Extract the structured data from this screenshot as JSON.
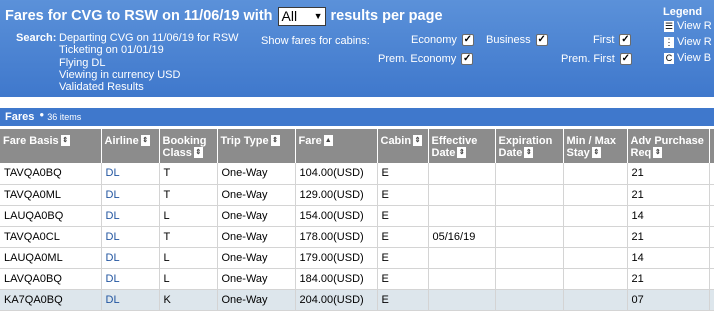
{
  "header": {
    "title_prefix": "Fares for CVG to RSW on 11/06/19 with",
    "per_page_value": "All",
    "title_suffix": "results per page",
    "search_label": "Search:",
    "search_lines": [
      "Departing CVG on 11/06/19 for RSW",
      "Ticketing on 01/01/19",
      "Flying DL",
      "Viewing in currency USD",
      "Validated Results"
    ],
    "cabins_label": "Show fares for cabins:",
    "cabins": [
      {
        "label": "Economy",
        "checked": true
      },
      {
        "label": "Business",
        "checked": true
      },
      {
        "label": "First",
        "checked": true
      },
      {
        "label": "Prem. Economy",
        "checked": true
      },
      {
        "label": "Prem. First",
        "checked": true
      }
    ],
    "legend": {
      "title": "Legend",
      "items": [
        {
          "icon": "view-rules-icon",
          "label": "View R"
        },
        {
          "icon": "view-routing-icon",
          "label": "View R"
        },
        {
          "icon": "view-b-icon",
          "label": "View B"
        }
      ]
    }
  },
  "fares": {
    "label": "Fares",
    "count": "36 items"
  },
  "table": {
    "headers": [
      {
        "line1": "Fare Basis",
        "line2": "",
        "sort": "sort-icon"
      },
      {
        "line1": "Airline",
        "line2": "",
        "sort": "sort-icon"
      },
      {
        "line1": "Booking",
        "line2": "Class",
        "sort": "sort-icon"
      },
      {
        "line1": "Trip Type",
        "line2": "",
        "sort": "sort-icon"
      },
      {
        "line1": "Fare",
        "line2": "",
        "sort": "sort-ascending-icon"
      },
      {
        "line1": "Cabin",
        "line2": "",
        "sort": "sort-icon"
      },
      {
        "line1": "Effective",
        "line2": "Date",
        "sort": "sort-icon"
      },
      {
        "line1": "Expiration",
        "line2": "Date",
        "sort": "sort-icon"
      },
      {
        "line1": "Min / Max",
        "line2": "Stay",
        "sort": "sort-icon"
      },
      {
        "line1": "Adv Purchase",
        "line2": "Req",
        "sort": "sort-icon"
      },
      {
        "line1": "",
        "line2": "",
        "sort": ""
      }
    ],
    "rows": [
      [
        "TAVQA0BQ",
        "DL",
        "T",
        "One-Way",
        "104.00(USD)",
        "E",
        "",
        "",
        "",
        "21",
        ""
      ],
      [
        "TAVQA0ML",
        "DL",
        "T",
        "One-Way",
        "129.00(USD)",
        "E",
        "",
        "",
        "",
        "21",
        ""
      ],
      [
        "LAUQA0BQ",
        "DL",
        "L",
        "One-Way",
        "154.00(USD)",
        "E",
        "",
        "",
        "",
        "14",
        ""
      ],
      [
        "TAVQA0CL",
        "DL",
        "T",
        "One-Way",
        "178.00(USD)",
        "E",
        "05/16/19",
        "",
        "",
        "21",
        ""
      ],
      [
        "LAUQA0ML",
        "DL",
        "L",
        "One-Way",
        "179.00(USD)",
        "E",
        "",
        "",
        "",
        "14",
        ""
      ],
      [
        "LAVQA0BQ",
        "DL",
        "L",
        "One-Way",
        "184.00(USD)",
        "E",
        "",
        "",
        "",
        "21",
        ""
      ],
      [
        "KA7QA0BQ",
        "DL",
        "K",
        "One-Way",
        "204.00(USD)",
        "E",
        "",
        "",
        "",
        "07",
        ""
      ]
    ]
  }
}
